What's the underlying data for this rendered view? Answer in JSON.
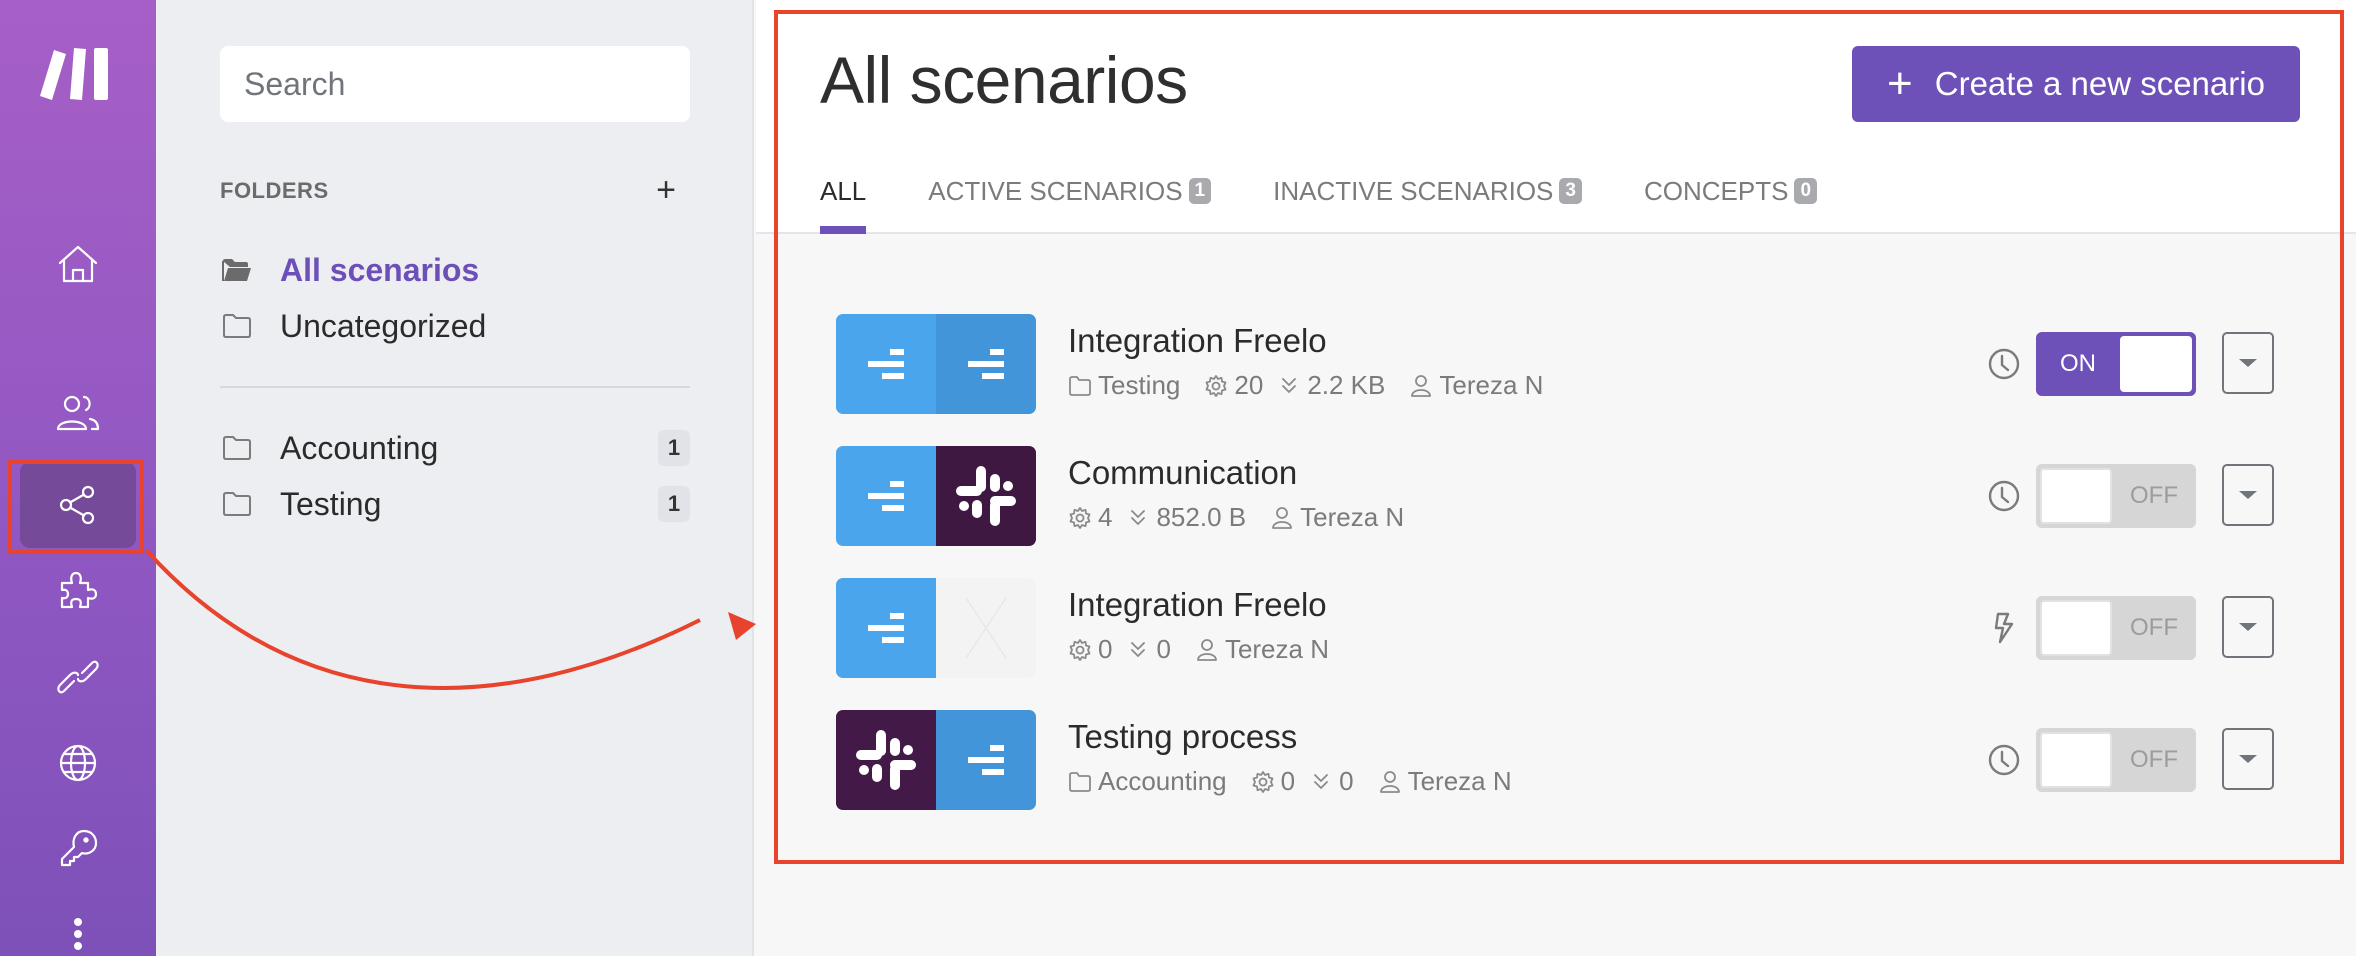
{
  "app": {
    "brand": "Make",
    "rail": [
      {
        "id": "home",
        "icon": "home-icon",
        "active": false
      },
      {
        "id": "team",
        "icon": "users-icon",
        "active": false
      },
      {
        "id": "scenarios",
        "icon": "share-icon",
        "active": true
      },
      {
        "id": "templates",
        "icon": "puzzle-icon",
        "active": false
      },
      {
        "id": "connections",
        "icon": "link-icon",
        "active": false
      },
      {
        "id": "webhooks",
        "icon": "globe-icon",
        "active": false
      },
      {
        "id": "keys",
        "icon": "key-icon",
        "active": false
      },
      {
        "id": "more",
        "icon": "more-vertical-icon",
        "active": false
      }
    ]
  },
  "sidebar": {
    "search": {
      "placeholder": "Search",
      "value": ""
    },
    "folders_label": "FOLDERS",
    "add_folder_icon": "plus-icon",
    "items": [
      {
        "label": "All scenarios",
        "icon": "folder-open-icon",
        "active": true
      },
      {
        "label": "Uncategorized",
        "icon": "folder-icon",
        "active": false
      }
    ],
    "folders": [
      {
        "label": "Accounting",
        "icon": "folder-icon",
        "count": "1"
      },
      {
        "label": "Testing",
        "icon": "folder-icon",
        "count": "1"
      }
    ]
  },
  "main": {
    "title": "All scenarios",
    "create_button": {
      "label": "Create a new scenario",
      "icon": "plus-icon"
    },
    "tabs": [
      {
        "label": "ALL",
        "badge": null,
        "active": true
      },
      {
        "label": "ACTIVE SCENARIOS",
        "badge": "1",
        "active": false
      },
      {
        "label": "INACTIVE SCENARIOS",
        "badge": "3",
        "active": false
      },
      {
        "label": "CONCEPTS",
        "badge": "0",
        "active": false
      }
    ],
    "scenarios": [
      {
        "name": "Integration Freelo",
        "apps": [
          "freelo",
          "freelo"
        ],
        "folder": "Testing",
        "operations": "20",
        "data": "2.2 KB",
        "owner": "Tereza N",
        "trigger": "clock-icon",
        "status": "ON",
        "active": true
      },
      {
        "name": "Communication",
        "apps": [
          "freelo",
          "slack"
        ],
        "folder": null,
        "operations": "4",
        "data": "852.0 B",
        "owner": "Tereza N",
        "trigger": "clock-icon",
        "status": "OFF",
        "active": false
      },
      {
        "name": "Integration Freelo",
        "apps": [
          "freelo",
          "empty"
        ],
        "folder": null,
        "operations": "0",
        "data": "0",
        "owner": "Tereza N",
        "trigger": "lightning-icon",
        "status": "OFF",
        "active": false
      },
      {
        "name": "Testing process",
        "apps": [
          "slack",
          "freelo"
        ],
        "folder": "Accounting",
        "operations": "0",
        "data": "0",
        "owner": "Tereza N",
        "trigger": "clock-icon",
        "status": "OFF",
        "active": false
      }
    ]
  },
  "colors": {
    "accent": "#6d50b8",
    "rail_top": "#a65fc6",
    "rail_bottom": "#7d51b8",
    "freelo": "#4aa5ec",
    "slack": "#3e1841",
    "annotation": "#e8432c"
  }
}
